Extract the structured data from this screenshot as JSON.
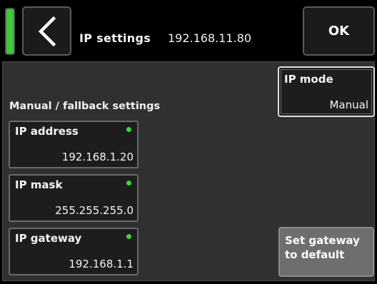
{
  "header": {
    "title": "IP settings",
    "current_ip": "192.168.11.80",
    "ok_label": "OK",
    "status_color": "#3ec93e"
  },
  "icons": {
    "back": "chevron-left-icon"
  },
  "section": {
    "label": "Manual / fallback settings"
  },
  "fields": [
    {
      "label": "IP address",
      "value": "192.168.1.20",
      "status": "active"
    },
    {
      "label": "IP mask",
      "value": "255.255.255.0",
      "status": "active"
    },
    {
      "label": "IP gateway",
      "value": "192.168.1.1",
      "status": "active"
    }
  ],
  "ip_mode": {
    "label": "IP mode",
    "value": "Manual"
  },
  "gateway_button": {
    "line1": "Set gateway",
    "line2": "to default"
  },
  "colors": {
    "led_green": "#36d936",
    "panel_bg": "#303030",
    "field_bg": "#1d1d1d"
  }
}
